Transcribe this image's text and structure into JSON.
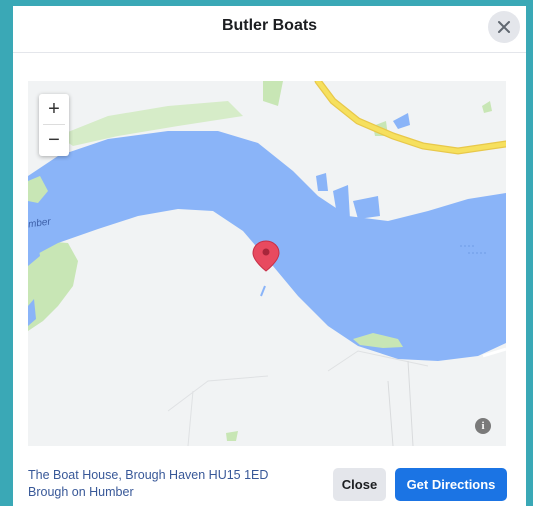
{
  "dialog": {
    "title": "Butler Boats",
    "close_icon": "close-icon"
  },
  "map": {
    "zoom_in_label": "+",
    "zoom_out_label": "−",
    "river_label": "mber",
    "info_label": "i",
    "colors": {
      "water": "#8ab4f8",
      "land": "#f1f3f4",
      "park": "#c8e6b5",
      "road": "#f6e05e",
      "marker": "#e84a5f"
    },
    "marker_icon": "location-pin-icon"
  },
  "footer": {
    "address_line1": "The Boat House, Brough Haven HU15 1ED",
    "address_line2": "Brough on Humber",
    "close_label": "Close",
    "directions_label": "Get Directions"
  }
}
